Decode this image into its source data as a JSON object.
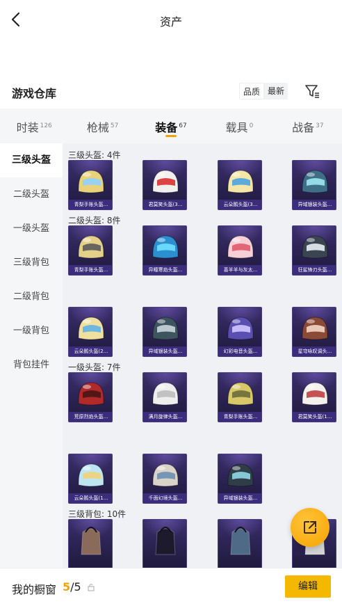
{
  "header": {
    "title": "资产",
    "back_icon": "chevron-left-icon"
  },
  "warehouse": {
    "title": "游戏仓库",
    "sort_options": [
      "品质",
      "最新"
    ],
    "filter_icon": "filter-icon"
  },
  "tabs": [
    {
      "label": "时装",
      "count": "126",
      "active": false
    },
    {
      "label": "枪械",
      "count": "57",
      "active": false
    },
    {
      "label": "装备",
      "count": "67",
      "active": true
    },
    {
      "label": "载具",
      "count": "0",
      "active": false
    },
    {
      "label": "战备",
      "count": "37",
      "active": false
    }
  ],
  "sidebar": {
    "items": [
      {
        "label": "三级头盔",
        "active": true
      },
      {
        "label": "二级头盔",
        "active": false
      },
      {
        "label": "一级头盔",
        "active": false
      },
      {
        "label": "三级背包",
        "active": false
      },
      {
        "label": "二级背包",
        "active": false
      },
      {
        "label": "一级背包",
        "active": false
      },
      {
        "label": "背包挂件",
        "active": false
      }
    ]
  },
  "sections": [
    {
      "label": "三级头盔: 4件",
      "items": [
        {
          "name": "青梨手账头盔...",
          "color": "#e8d27a",
          "accent": "#8fd0ff"
        },
        {
          "name": "君莫笑头盔(3...",
          "color": "#f2f0ee",
          "accent": "#d93030"
        },
        {
          "name": "云朵鹅头盔(3...",
          "color": "#f3e6a8",
          "accent": "#4aa3e0"
        },
        {
          "name": "异域银装头盔...",
          "color": "#3f6f86",
          "accent": "#9be7f2"
        }
      ]
    },
    {
      "label": "二级头盔: 8件",
      "items": [
        {
          "name": "青梨手账头盔...",
          "color": "#e3d089",
          "accent": "#5a5a5a"
        },
        {
          "name": "异瞳寒焰头盔...",
          "color": "#2c8fd0",
          "accent": "#6fe0ff"
        },
        {
          "name": "喜羊羊与灰太...",
          "color": "#f6cfd7",
          "accent": "#e05a6a"
        },
        {
          "name": "狂鲨锋刃头盔...",
          "color": "#3b4552",
          "accent": "#e9eef3"
        },
        {
          "name": "云朵鹅头盔(2...",
          "color": "#f0e0a0",
          "accent": "#5eb3e8"
        },
        {
          "name": "异域银装头盔...",
          "color": "#3e5560",
          "accent": "#c8d6dc"
        },
        {
          "name": "幻彩电音头盔...",
          "color": "#5a4fb0",
          "accent": "#d0c8ff"
        },
        {
          "name": "星穹咏叹调头...",
          "color": "#8b4a36",
          "accent": "#f2d6c4"
        }
      ]
    },
    {
      "label": "一级头盔: 7件",
      "items": [
        {
          "name": "荒原烈焰头盔...",
          "color": "#b02a2a",
          "accent": "#4a1414"
        },
        {
          "name": "满月旋律头盔...",
          "color": "#eeeeee",
          "accent": "#bdbdbd"
        },
        {
          "name": "青梨手账头盔...",
          "color": "#d8c86a",
          "accent": "#6b6b3a"
        },
        {
          "name": "君莫笑头盔(1...",
          "color": "#f3f0ee",
          "accent": "#c04040"
        },
        {
          "name": "云朵鹅头盔(1...",
          "color": "#bfe5f2",
          "accent": "#f1d27a"
        },
        {
          "name": "千面幻境头盔...",
          "color": "#d9d3c8",
          "accent": "#6b8fb4"
        },
        {
          "name": "异域银装头盔...",
          "color": "#2e3d46",
          "accent": "#8fd6e4"
        }
      ]
    },
    {
      "label": "三级背包: 10件",
      "items": [
        {
          "name": "",
          "color": "#8a6a5a",
          "accent": "#1d1a2d"
        },
        {
          "name": "",
          "color": "#1d1a2d",
          "accent": "#222"
        },
        {
          "name": "",
          "color": "#4f6a86",
          "accent": "#1d1a2d"
        },
        {
          "name": "",
          "color": "#d2d2d2",
          "accent": "#1d1a2d"
        }
      ]
    }
  ],
  "share": {
    "icon": "share-icon"
  },
  "showcase": {
    "label": "我的橱窗",
    "current": "5",
    "total": "/5",
    "lock_icon": "lock-icon"
  },
  "edit_button": "编辑"
}
